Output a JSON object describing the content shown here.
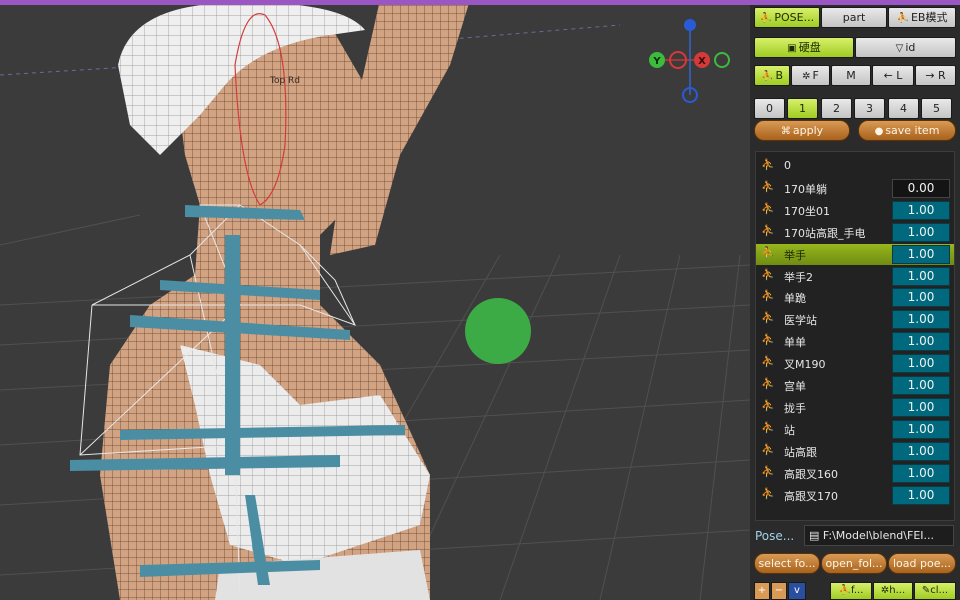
{
  "panel": {
    "tabs": [
      {
        "icon": "pose-figure-icon",
        "label": "POSE..."
      },
      {
        "icon": "",
        "label": "part"
      },
      {
        "icon": "pose-figure-icon",
        "label": "EB模式"
      }
    ],
    "row2": [
      {
        "icon": "save-icon",
        "label": "硬盘"
      },
      {
        "icon": "filter-triangle-icon",
        "label": "id"
      }
    ],
    "row3": [
      {
        "icon": "pose-figure-icon",
        "label": "B"
      },
      {
        "icon": "bulb-icon",
        "label": "F"
      },
      {
        "icon": "",
        "label": "M"
      },
      {
        "icon": "",
        "label": "← L"
      },
      {
        "icon": "",
        "label": "→ R"
      }
    ],
    "segments": [
      "0",
      "1",
      "2",
      "3",
      "4",
      "5"
    ],
    "selected_segment": "1",
    "apply": {
      "icon": "butterfly-icon",
      "label": "apply"
    },
    "save_item": {
      "icon": "dot-icon",
      "label": "save item"
    },
    "poses": [
      {
        "name": "0",
        "value": ""
      },
      {
        "name": "170单躺",
        "value": "0.00"
      },
      {
        "name": "170坐01",
        "value": "1.00"
      },
      {
        "name": "170站高跟_手电",
        "value": "1.00"
      },
      {
        "name": "举手",
        "value": "1.00"
      },
      {
        "name": "举手2",
        "value": "1.00"
      },
      {
        "name": "单跪",
        "value": "1.00"
      },
      {
        "name": "医学站",
        "value": "1.00"
      },
      {
        "name": "单单",
        "value": "1.00"
      },
      {
        "name": "叉M190",
        "value": "1.00"
      },
      {
        "name": "宫单",
        "value": "1.00"
      },
      {
        "name": "拢手",
        "value": "1.00"
      },
      {
        "name": "站",
        "value": "1.00"
      },
      {
        "name": "站高跟",
        "value": "1.00"
      },
      {
        "name": "高跟叉160",
        "value": "1.00"
      },
      {
        "name": "高跟叉170",
        "value": "1.00"
      }
    ],
    "selected_pose": "举手",
    "path_label": "Pose...",
    "path_value": "F:\\Model\\blend\\FEI...",
    "bottom_buttons": [
      "select fo...",
      "open_fol...",
      "load poe..."
    ],
    "small_buttons": [
      "+",
      "−",
      "v",
      "f...",
      "h...",
      "cl..."
    ]
  },
  "viewport": {
    "head_label": "Top Rd",
    "gizmo": {
      "y": "Y",
      "x": "X",
      "z": "Z"
    },
    "colors": {
      "accent": "#97b61d",
      "value_bg": "#00697d",
      "gizmo_y": "#3dbb3d",
      "gizmo_x": "#d43a3a",
      "gizmo_z": "#2a5bd7",
      "marker": "#3cab46",
      "skin": "#d2a383",
      "bone": "#4b8ea3"
    }
  }
}
